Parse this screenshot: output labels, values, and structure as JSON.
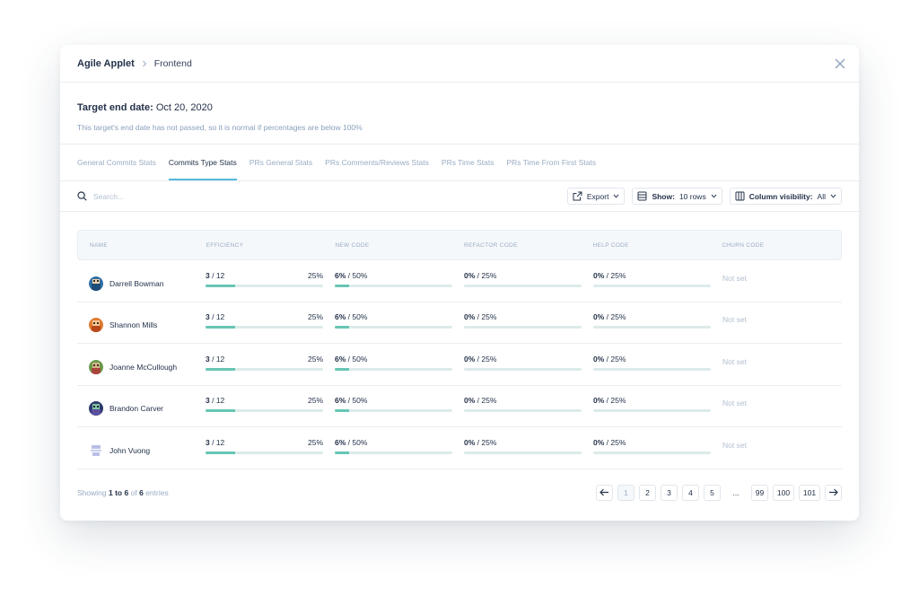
{
  "header": {
    "app": "Agile Applet",
    "project": "Frontend"
  },
  "target": {
    "title_label": "Target end date:",
    "title_value": "Oct 20, 2020",
    "note": "This target's end date has not passed, so it is normal if percentages are below 100%"
  },
  "tabs": [
    "General Commits Stats",
    "Commits Type Stats",
    "PRs General Stats",
    "PRs Comments/Reviews Stats",
    "PRs Time Stats",
    "PRs Time From First Stats"
  ],
  "active_tab": "Commits Type Stats",
  "toolbar": {
    "search_placeholder": "Search...",
    "export_label": "Export",
    "show_label": "Show:",
    "show_value": "10 rows",
    "columns_label": "Column visibility:",
    "columns_value": "All"
  },
  "table": {
    "headers": [
      "NAME",
      "EFFICIENCY",
      "NEW CODE",
      "REFACTOR CODE",
      "HELP CODE",
      "CHURN CODE"
    ],
    "rows": [
      {
        "name": "Darrell Bowman",
        "avatar": "avatar-blue",
        "eff_value": "3",
        "eff_total": "12",
        "eff_pct": "25%",
        "eff_fill": 0.25,
        "new_value": "6%",
        "new_target": "50%",
        "new_fill": 0.12,
        "ref_value": "0%",
        "ref_target": "25%",
        "ref_fill": 0,
        "help_value": "0%",
        "help_target": "25%",
        "help_fill": 0,
        "churn": "Not set"
      },
      {
        "name": "Shannon Mills",
        "avatar": "avatar-orange",
        "eff_value": "3",
        "eff_total": "12",
        "eff_pct": "25%",
        "eff_fill": 0.25,
        "new_value": "6%",
        "new_target": "50%",
        "new_fill": 0.12,
        "ref_value": "0%",
        "ref_target": "25%",
        "ref_fill": 0,
        "help_value": "0%",
        "help_target": "25%",
        "help_fill": 0,
        "churn": "Not set"
      },
      {
        "name": "Joanne McCullough",
        "avatar": "avatar-green",
        "eff_value": "3",
        "eff_total": "12",
        "eff_pct": "25%",
        "eff_fill": 0.25,
        "new_value": "6%",
        "new_target": "50%",
        "new_fill": 0.12,
        "ref_value": "0%",
        "ref_target": "25%",
        "ref_fill": 0,
        "help_value": "0%",
        "help_target": "25%",
        "help_fill": 0,
        "churn": "Not set"
      },
      {
        "name": "Brandon Carver",
        "avatar": "avatar-navy",
        "eff_value": "3",
        "eff_total": "12",
        "eff_pct": "25%",
        "eff_fill": 0.25,
        "new_value": "6%",
        "new_target": "50%",
        "new_fill": 0.12,
        "ref_value": "0%",
        "ref_target": "25%",
        "ref_fill": 0,
        "help_value": "0%",
        "help_target": "25%",
        "help_fill": 0,
        "churn": "Not set"
      },
      {
        "name": "John Vuong",
        "avatar": "avatar-lavender",
        "eff_value": "3",
        "eff_total": "12",
        "eff_pct": "25%",
        "eff_fill": 0.25,
        "new_value": "6%",
        "new_target": "50%",
        "new_fill": 0.12,
        "ref_value": "0%",
        "ref_target": "25%",
        "ref_fill": 0,
        "help_value": "0%",
        "help_target": "25%",
        "help_fill": 0,
        "churn": "Not set"
      }
    ]
  },
  "footer": {
    "showing_prefix": "Showing",
    "from": "1",
    "to_word": "to",
    "to": "6",
    "of_word": "of",
    "total": "6",
    "entries_word": "entries",
    "pages": [
      "1",
      "2",
      "3",
      "4",
      "5",
      "...",
      "99",
      "100",
      "101"
    ],
    "current_page": "1"
  },
  "colors": {
    "accent": "#56b8d8",
    "bar_fill": "#68c5b4",
    "bar_track": "#dcebea",
    "muted_text": "#9aacc3",
    "dark_text": "#24324a"
  }
}
